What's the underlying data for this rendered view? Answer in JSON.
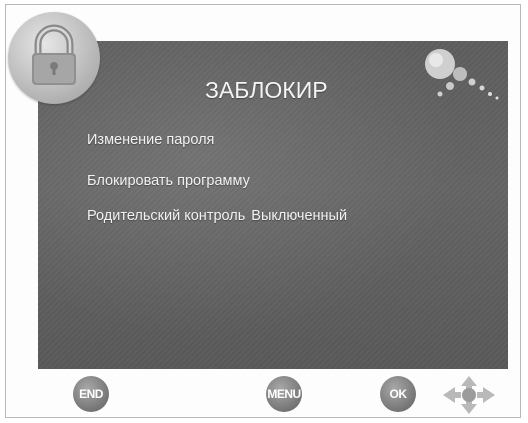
{
  "screen": {
    "title": "ЗАБЛОКИР",
    "menu": [
      {
        "label": "Изменение пароля"
      },
      {
        "label": "Блокировать программу"
      },
      {
        "label": "Родительский контроль",
        "value": "Выключенный"
      }
    ]
  },
  "icons": {
    "badge": "padlock-icon",
    "decoration": "bubbles-icon",
    "navigation": "direction-pad-icon"
  },
  "buttons": {
    "end": "END",
    "menu": "MENU",
    "ok": "OK"
  },
  "colors": {
    "screen_background": "#606060",
    "text": "#f2f2f2",
    "button": "#7c7c7c"
  }
}
